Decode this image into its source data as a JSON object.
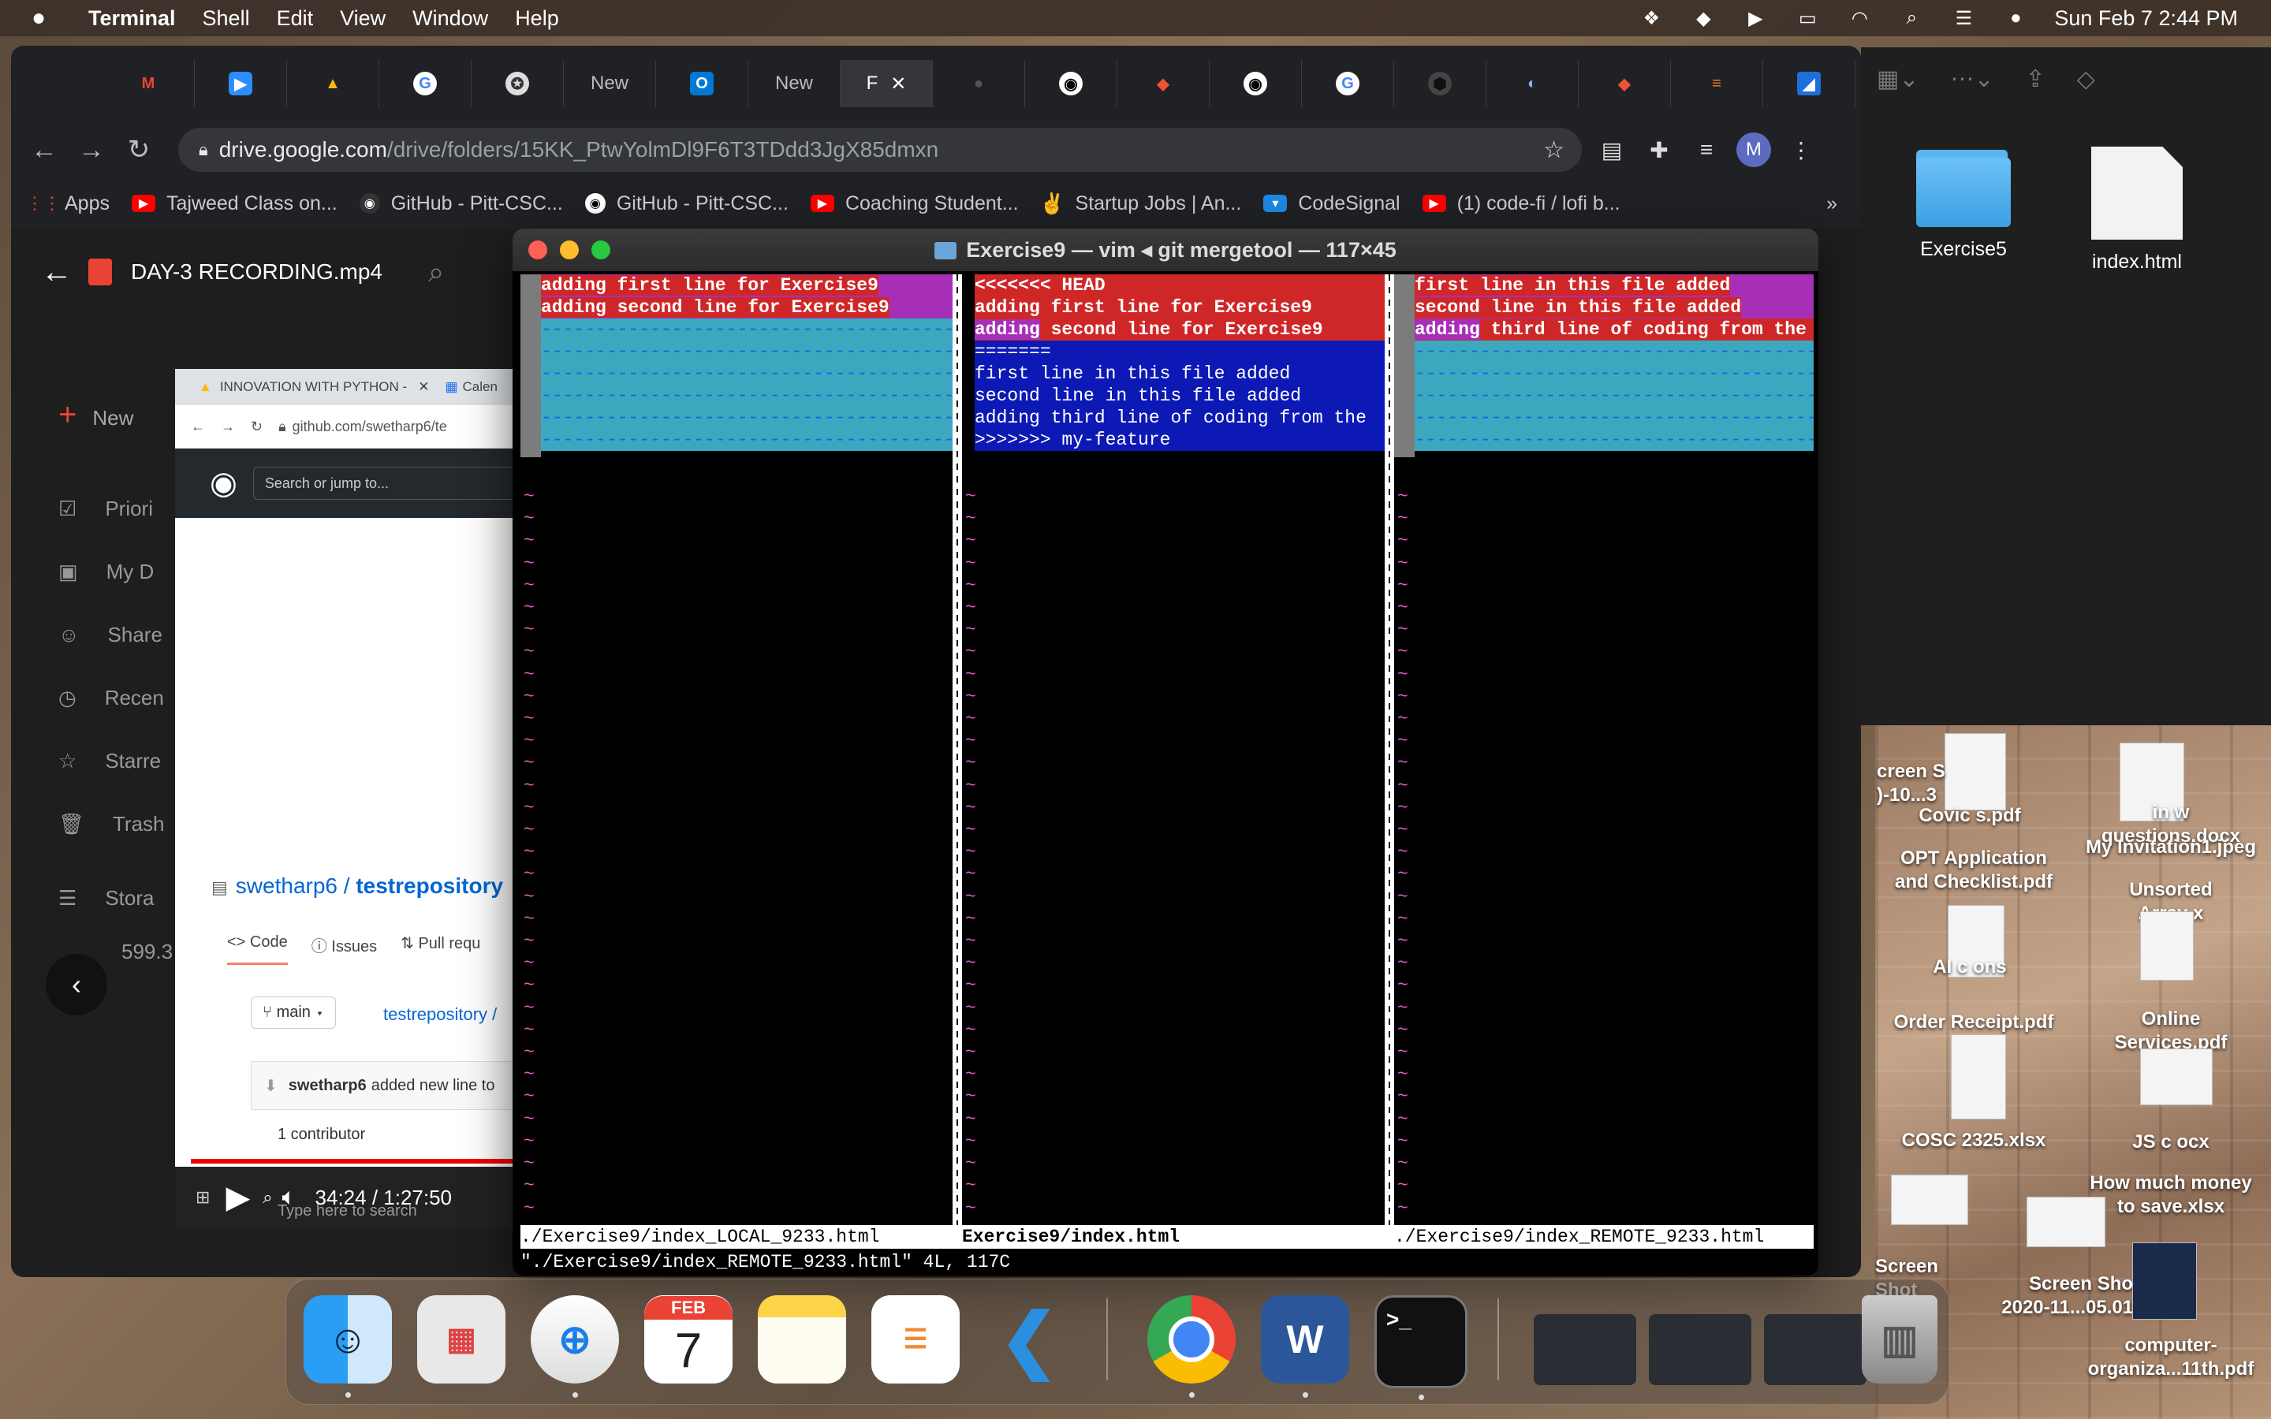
{
  "menubar": {
    "app": "Terminal",
    "menus": [
      "Shell",
      "Edit",
      "View",
      "Window",
      "Help"
    ],
    "clock": "Sun Feb 7  2:44 PM"
  },
  "chrome": {
    "tabs": [
      "New",
      "New",
      "F"
    ],
    "url_host": "drive.google.com",
    "url_path": "/drive/folders/15KK_PtwYolmDl9F6T3TDdd3JgX85dmxn",
    "avatar": "M",
    "bookmarks": [
      {
        "label": "Apps",
        "color": "#ea4335"
      },
      {
        "label": "Tajweed Class on...",
        "color": "#ff0000"
      },
      {
        "label": "GitHub - Pitt-CSC...",
        "color": "#333333"
      },
      {
        "label": "GitHub - Pitt-CSC...",
        "color": "#ffffff"
      },
      {
        "label": "Coaching Student...",
        "color": "#ff0000"
      },
      {
        "label": "Startup Jobs | An...",
        "color": "#ffffff"
      },
      {
        "label": "CodeSignal",
        "color": "#1e88e5"
      },
      {
        "label": "(1) code-fi / lofi b...",
        "color": "#ff0000"
      }
    ],
    "more_bookmarks": "»"
  },
  "drive": {
    "file_title": "DAY-3 RECORDING.mp4",
    "new_label": "New",
    "sidebar": [
      "Priori",
      "My D",
      "Share",
      "Recen",
      "Starre",
      "Trash",
      "Stora",
      "599.3"
    ]
  },
  "video": {
    "tab1": "INNOVATION WITH PYTHON -",
    "tab2": "Calen",
    "url": "github.com/swetharp6/te",
    "search": "Search or jump to...",
    "repo_owner": "swetharp6",
    "repo_name": "testrepository",
    "code_tab": "Code",
    "issues_tab": "Issues",
    "pr_tab": "Pull requ",
    "branch": "main",
    "repo_link": "testrepository /",
    "commit_user": "swetharp6",
    "commit_msg": "added new line to",
    "contributor": "1 contributor",
    "time": "34:24 / 1:27:50",
    "taskbar_search": "Type here to search"
  },
  "terminal": {
    "title": "Exercise9 — vim ◂ git mergetool — 117×45",
    "local_lines": [
      "adding first line for Exercise9",
      "adding second line for Exercise9"
    ],
    "base": {
      "head_marker": "<<<<<<< HEAD",
      "line1": "adding first line for Exercise9",
      "line2_prefix": "adding",
      "line2_rest": " second line for Exercise9",
      "sep": "=======",
      "new1": "first line in this file added",
      "new2": "second line in this file added",
      "new3": "adding third line of coding from the",
      "end_marker": ">>>>>>> my-feature"
    },
    "remote": {
      "line1": "first line in this file added",
      "line2": "second line in this file added",
      "line3_prefix": "adding",
      "line3_rest": " third line of coding from the"
    },
    "filler": "-----------------------------------------",
    "status_left": "./Exercise9/index_LOCAL_9233.html",
    "status_mid": "Exercise9/index.html",
    "status_right": "./Exercise9/index_REMOTE_9233.html",
    "cmdline": "\"./Exercise9/index_REMOTE_9233.html\" 4L, 117C"
  },
  "finder": {
    "items": [
      {
        "label": "Exercise5",
        "type": "folder"
      },
      {
        "label": "index.html",
        "type": "file"
      }
    ]
  },
  "desktop": {
    "files": [
      "creen S\n)-10...3",
      "Covic     s.pdf",
      "OPT Application\nand Checklist.pdf",
      "AI  c    ons",
      "Order Receipt.pdf",
      "COSC 2325.xlsx",
      "Screen Shot\n    PM",
      "in     w\nquestions.docx",
      "My Invitation1.jpeg",
      "Unsorted\nArray     x",
      "Online\nServices.pdf",
      "JS c          ocx",
      "How much money\nto save.xlsx",
      "Screen Shot\n2020-11...05.01 PM",
      "computer-\norganiza...11th.pdf"
    ]
  },
  "dock": {
    "calendar_month": "FEB",
    "calendar_day": "7",
    "apps": [
      "finder",
      "launchpad",
      "safari",
      "calendar",
      "notes",
      "reminders",
      "vscode",
      "chrome",
      "word",
      "terminal"
    ]
  }
}
